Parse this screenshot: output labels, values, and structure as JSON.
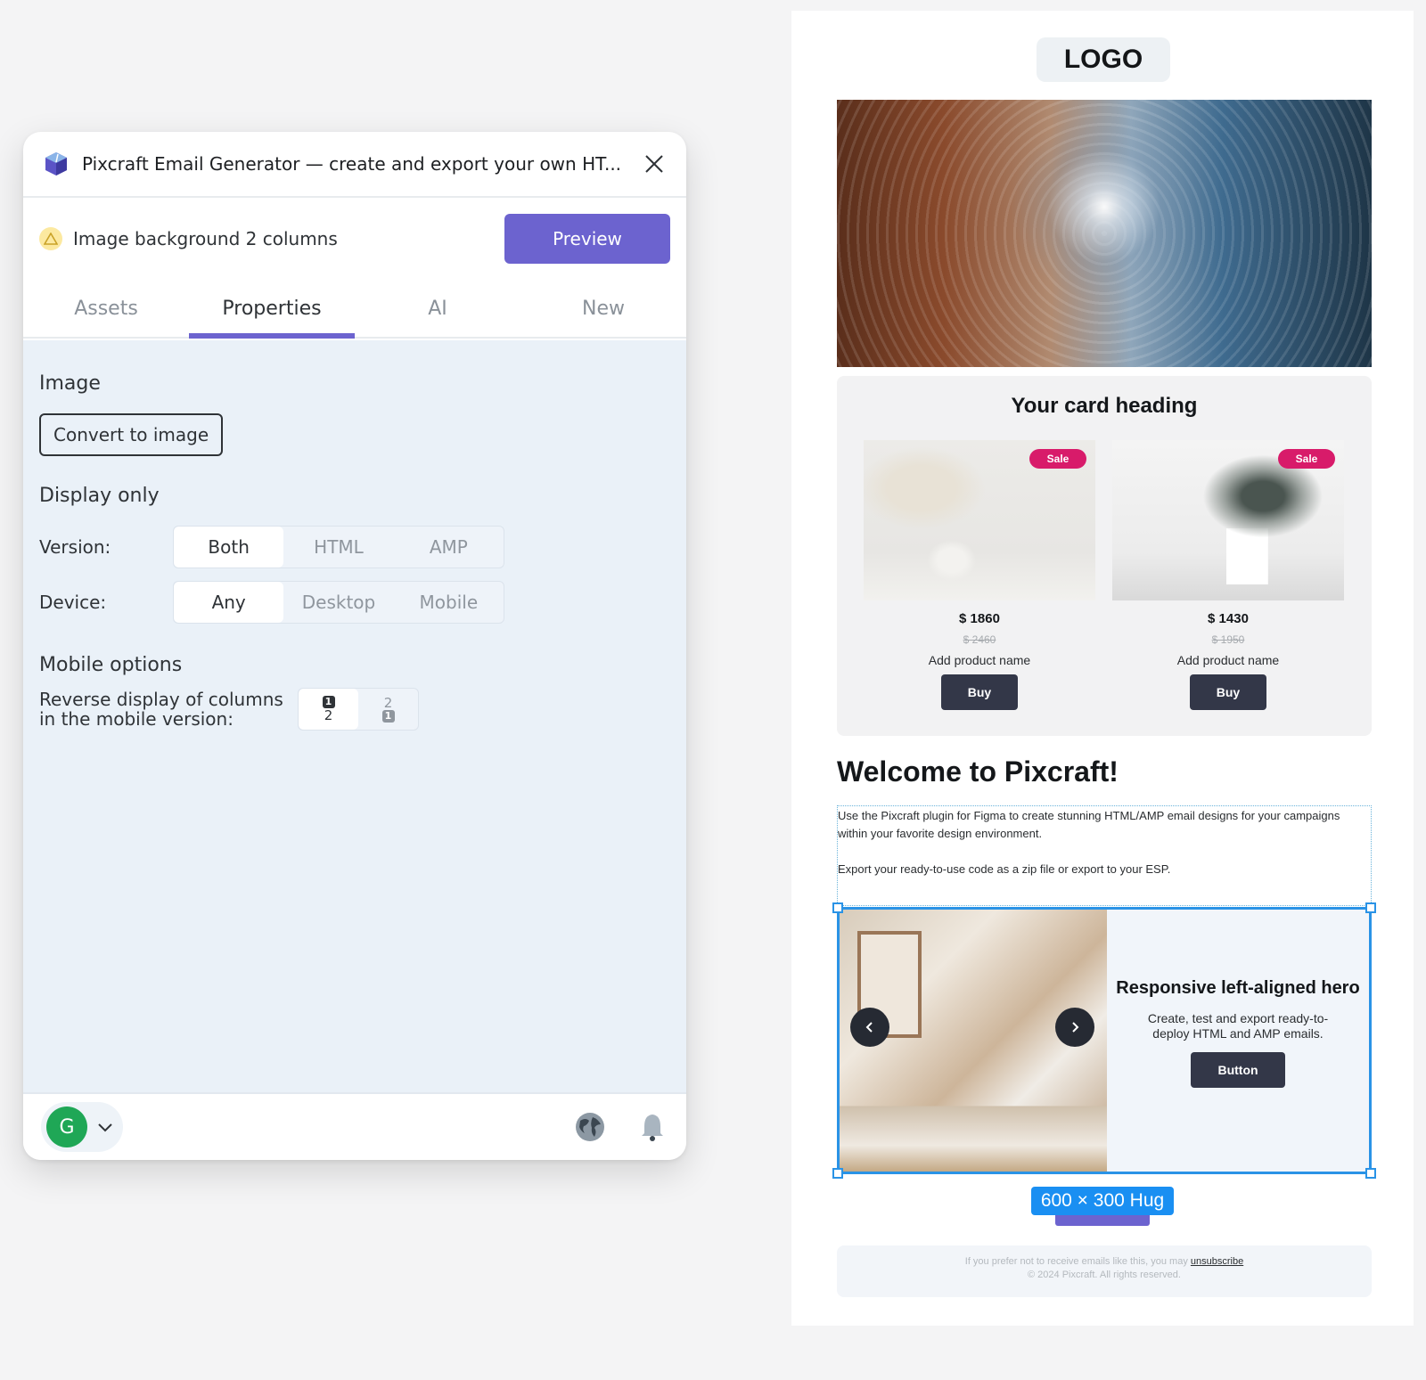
{
  "plugin": {
    "title": "Pixcraft Email Generator — create and export your own HT...",
    "context_label": "Image background 2 columns",
    "preview_label": "Preview",
    "tabs": [
      {
        "label": "Assets",
        "active": false
      },
      {
        "label": "Properties",
        "active": true
      },
      {
        "label": "AI",
        "active": false
      },
      {
        "label": "New",
        "active": false
      }
    ],
    "properties": {
      "image_section": "Image",
      "convert_label": "Convert to image",
      "display_section": "Display only",
      "version_label": "Version:",
      "version_options": [
        "Both",
        "HTML",
        "AMP"
      ],
      "version_selected": "Both",
      "device_label": "Device:",
      "device_options": [
        "Any",
        "Desktop",
        "Mobile"
      ],
      "device_selected": "Any",
      "mobile_section": "Mobile options",
      "reverse_label_line1": "Reverse display of columns",
      "reverse_label_line2": "in the mobile version:",
      "reverse_options": [
        {
          "top": "1",
          "bottom": "2",
          "active": true
        },
        {
          "top": "2",
          "bottom": "1",
          "active": false
        }
      ]
    },
    "footer": {
      "avatar_initial": "G",
      "avatar_color": "#1fa756"
    },
    "accent_color": "#6c63cf"
  },
  "email": {
    "logo": "LOGO",
    "card": {
      "heading": "Your card heading",
      "products": [
        {
          "badge": "Sale",
          "price": "$ 1860",
          "old_price": "$ 2460",
          "name": "Add product name",
          "button": "Buy"
        },
        {
          "badge": "Sale",
          "price": "$ 1430",
          "old_price": "$ 1950",
          "name": "Add product name",
          "button": "Buy"
        }
      ]
    },
    "welcome_heading": "Welcome to Pixcraft!",
    "intro_p1": "Use the Pixcraft plugin for Figma to create stunning HTML/AMP email designs for your campaigns within your favorite design environment.",
    "intro_p2": "Export your ready-to-use code as a zip file or export to your ESP.",
    "hero": {
      "title": "Responsive left-aligned hero",
      "description": "Create, test and export ready-to-deploy HTML and AMP emails.",
      "button": "Button"
    },
    "selection_size": "600 × 300 Hug",
    "footer_text": "If you prefer not to receive emails like this, you may",
    "unsubscribe": "unsubscribe",
    "copyright": "© 2024 Pixcraft. All rights reserved.",
    "selection_color": "#2a93e6",
    "sale_color": "#d81b6a"
  }
}
